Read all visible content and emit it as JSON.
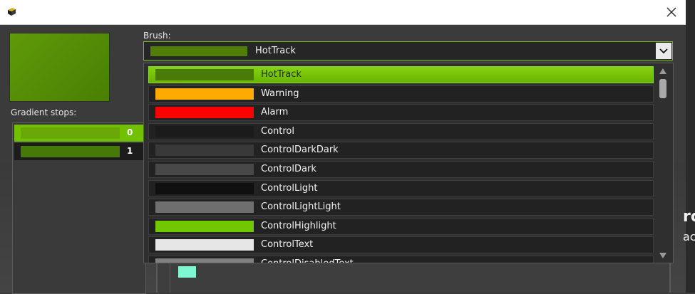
{
  "window": {
    "icon": "app-box-icon",
    "close_icon": "close-icon"
  },
  "gradient": {
    "label": "Gradient stops:",
    "stops": [
      {
        "offset": "0",
        "color": "#6aa80a",
        "selected": true
      },
      {
        "offset": "1",
        "color": "#457a07",
        "selected": false
      }
    ]
  },
  "brush": {
    "label": "Brush:",
    "selected": {
      "name": "HotTrack",
      "color": "#4f7f08"
    }
  },
  "brush_list": [
    {
      "name": "HotTrack",
      "color": "#4a7a08",
      "selected": true
    },
    {
      "name": "Warning",
      "color": "#ffaa00"
    },
    {
      "name": "Alarm",
      "color": "#ff0000"
    },
    {
      "name": "Control",
      "color": "#1b1b1b"
    },
    {
      "name": "ControlDarkDark",
      "color": "#393939"
    },
    {
      "name": "ControlDark",
      "color": "#484848"
    },
    {
      "name": "ControlLight",
      "color": "#101010"
    },
    {
      "name": "ControlLightLight",
      "color": "#6e6e6e"
    },
    {
      "name": "ControlHighlight",
      "color": "#72c800"
    },
    {
      "name": "ControlText",
      "color": "#e6e6e6"
    },
    {
      "name": "ControlDisabledText",
      "color": "#808080"
    }
  ],
  "background": {
    "partial_text_1": "ro",
    "partial_text_2": "ac",
    "swatch_color": "#7ff7d2"
  }
}
